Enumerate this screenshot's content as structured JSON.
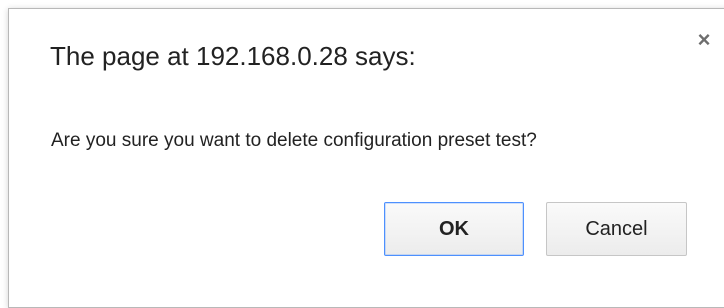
{
  "dialog": {
    "title": "The page at 192.168.0.28 says:",
    "message": "Are you sure you want to delete configuration preset test?",
    "close_icon": "×",
    "buttons": {
      "ok_label": "OK",
      "cancel_label": "Cancel"
    }
  },
  "colors": {
    "ok_border": "#4d90fe",
    "text": "#222222"
  },
  "icons": {
    "close": "close-icon"
  }
}
